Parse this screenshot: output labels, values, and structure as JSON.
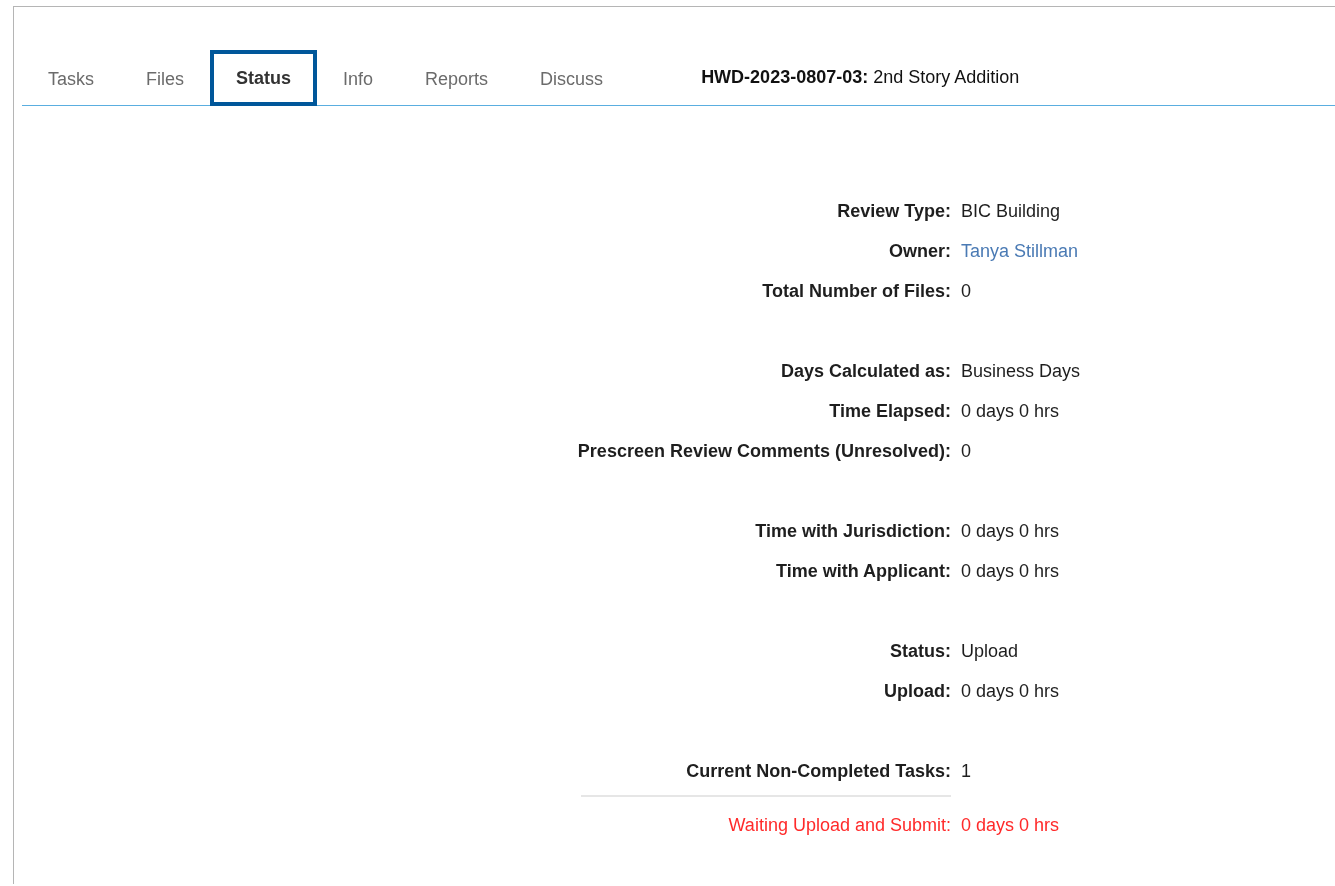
{
  "tabs": [
    {
      "label": "Tasks",
      "selected": false
    },
    {
      "label": "Files",
      "selected": false
    },
    {
      "label": "Status",
      "selected": true
    },
    {
      "label": "Info",
      "selected": false
    },
    {
      "label": "Reports",
      "selected": false
    },
    {
      "label": "Discuss",
      "selected": false
    }
  ],
  "project": {
    "id": "HWD-2023-0807-03:",
    "name": "2nd Story Addition"
  },
  "groups": [
    {
      "rows": [
        {
          "label": "Review Type:",
          "value": "BIC Building",
          "kind": "text",
          "rule_above": false
        },
        {
          "label": "Owner:",
          "value": "Tanya Stillman",
          "kind": "link",
          "rule_above": false
        },
        {
          "label": "Total Number of Files:",
          "value": "0",
          "kind": "text",
          "rule_above": false
        }
      ]
    },
    {
      "rows": [
        {
          "label": "Days Calculated as:",
          "value": "Business Days",
          "kind": "text",
          "rule_above": false
        },
        {
          "label": "Time Elapsed:",
          "value": "0 days 0 hrs",
          "kind": "text",
          "rule_above": false
        },
        {
          "label": "Prescreen Review Comments (Unresolved):",
          "value": "0",
          "kind": "text",
          "rule_above": false
        }
      ]
    },
    {
      "rows": [
        {
          "label": "Time with Jurisdiction:",
          "value": "0 days 0 hrs",
          "kind": "text",
          "rule_above": false
        },
        {
          "label": "Time with Applicant:",
          "value": "0 days 0 hrs",
          "kind": "text",
          "rule_above": false
        }
      ]
    },
    {
      "rows": [
        {
          "label": "Status:",
          "value": "Upload",
          "kind": "text",
          "rule_above": false
        },
        {
          "label": "Upload:",
          "value": "0 days 0 hrs",
          "kind": "text",
          "rule_above": false
        }
      ]
    },
    {
      "rows": [
        {
          "label": "Current Non-Completed Tasks:",
          "value": "1",
          "kind": "text",
          "rule_above": false
        },
        {
          "label": "Waiting Upload and Submit:",
          "value": "0 days 0 hrs",
          "kind": "alert",
          "rule_above": true
        }
      ]
    }
  ]
}
